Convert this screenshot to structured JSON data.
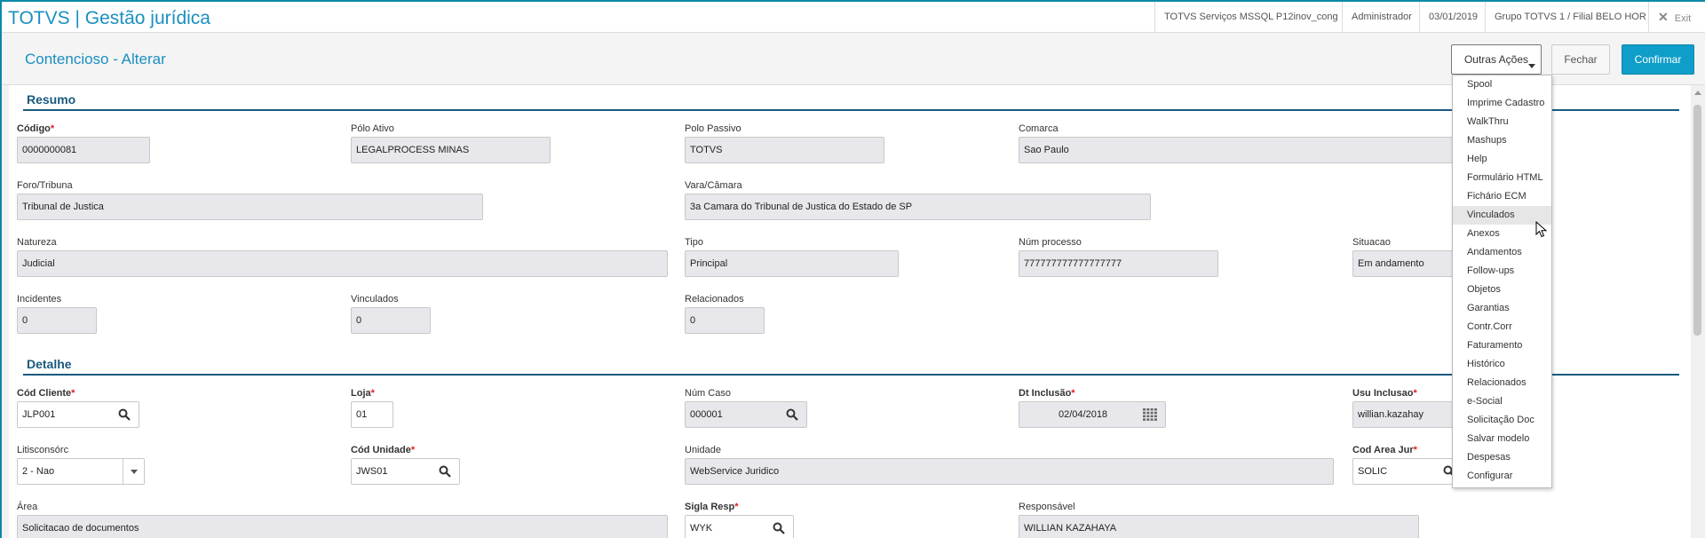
{
  "app": {
    "title": "TOTVS | Gestão jurídica"
  },
  "topbar": {
    "environment": "TOTVS Serviços MSSQL P12inov_cong",
    "user": "Administrador",
    "date": "03/01/2019",
    "branch": "Grupo TOTVS 1 / Filial BELO HOR",
    "exit_label": "Exit"
  },
  "page": {
    "title": "Contencioso - Alterar"
  },
  "actions": {
    "more_label": "Outras Ações",
    "close_label": "Fechar",
    "confirm_label": "Confirmar"
  },
  "sections": {
    "resumo": "Resumo",
    "detalhe": "Detalhe"
  },
  "resumo": {
    "codigo": {
      "label": "Código",
      "value": "0000000081"
    },
    "polo_ativo": {
      "label": "Pólo Ativo",
      "value": "LEGALPROCESS MINAS"
    },
    "polo_passivo": {
      "label": "Polo Passivo",
      "value": "TOTVS"
    },
    "comarca": {
      "label": "Comarca",
      "value": "Sao Paulo"
    },
    "foro": {
      "label": "Foro/Tribuna",
      "value": "Tribunal de Justica"
    },
    "vara": {
      "label": "Vara/Câmara",
      "value": "3a Camara do Tribunal de Justica do Estado de SP"
    },
    "natureza": {
      "label": "Natureza",
      "value": "Judicial"
    },
    "tipo": {
      "label": "Tipo",
      "value": "Principal"
    },
    "num_processo": {
      "label": "Núm processo",
      "value": "777777777777777777"
    },
    "situacao": {
      "label": "Situacao",
      "value": "Em andamento"
    },
    "incidentes": {
      "label": "Incidentes",
      "value": "0"
    },
    "vinculados": {
      "label": "Vinculados",
      "value": "0"
    },
    "relacionados": {
      "label": "Relacionados",
      "value": "0"
    }
  },
  "detalhe": {
    "cod_cliente": {
      "label": "Cód Cliente",
      "value": "JLP001"
    },
    "loja": {
      "label": "Loja",
      "value": "01"
    },
    "num_caso": {
      "label": "Núm Caso",
      "value": "000001"
    },
    "dt_inclusao": {
      "label": "Dt Inclusão",
      "value": "02/04/2018"
    },
    "usu_inclusao": {
      "label": "Usu Inclusao",
      "value": "willian.kazahay"
    },
    "litisconsorc": {
      "label": "Litisconsórc",
      "value": "2 - Nao"
    },
    "cod_unidade": {
      "label": "Cód Unidade",
      "value": "JWS01"
    },
    "unidade": {
      "label": "Unidade",
      "value": "WebService Juridico"
    },
    "cod_area_jur": {
      "label": "Cod Area Jur",
      "value": "SOLIC"
    },
    "area": {
      "label": "Área",
      "value": "Solicitacao de documentos"
    },
    "sigla_resp": {
      "label": "Sigla Resp",
      "value": "WYK"
    },
    "responsavel": {
      "label": "Responsável",
      "value": "WILLIAN KAZAHAYA"
    }
  },
  "menu": {
    "items": [
      "Spool",
      "Imprime Cadastro",
      "WalkThru",
      "Mashups",
      "Help",
      "Formulário HTML",
      "Fichário ECM",
      "Vinculados",
      "Anexos",
      "Andamentos",
      "Follow-ups",
      "Objetos",
      "Garantias",
      "Contr.Corr",
      "Faturamento",
      "Histórico",
      "Relacionados",
      "e-Social",
      "Solicitação Doc",
      "Salvar modelo",
      "Despesas",
      "Configurar"
    ],
    "highlighted": "Vinculados"
  },
  "icons": {
    "search": "search-icon",
    "calendar": "calendar-icon",
    "dropdown": "chevron-down-icon",
    "cursor": "mouse-pointer-icon"
  },
  "colors": {
    "accent": "#1a8fc0",
    "section": "#1a5a7f",
    "confirm": "#0f9ec9",
    "required": "#e02020"
  }
}
